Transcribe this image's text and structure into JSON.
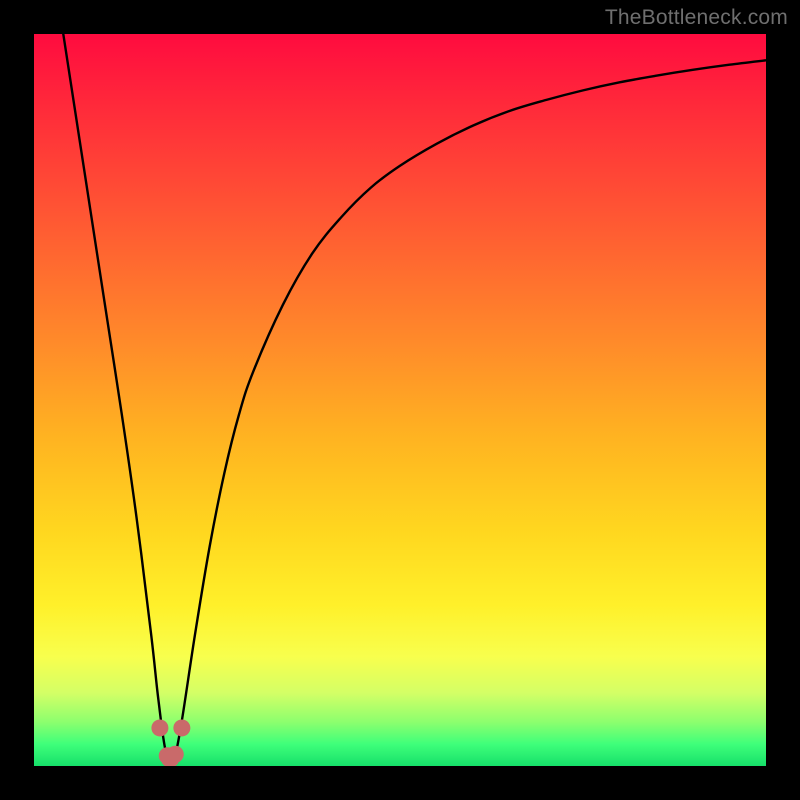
{
  "watermark": "TheBottleneck.com",
  "colors": {
    "frame": "#000000",
    "curve_stroke": "#000000",
    "marker_fill": "#c96a6a",
    "marker_stroke": "#c96a6a",
    "gradient_top": "#ff0b3f",
    "gradient_bottom": "#16e06a"
  },
  "chart_data": {
    "type": "line",
    "title": "",
    "xlabel": "",
    "ylabel": "",
    "xlim": [
      0,
      100
    ],
    "ylim": [
      0,
      100
    ],
    "x": [
      4,
      6,
      8,
      10,
      12,
      14,
      16,
      17,
      18,
      19,
      20,
      22,
      24,
      26,
      28,
      30,
      34,
      38,
      42,
      46,
      50,
      55,
      60,
      65,
      70,
      75,
      80,
      85,
      90,
      95,
      100
    ],
    "values": [
      100,
      87,
      74,
      61,
      48,
      34,
      18,
      9,
      2,
      1,
      5,
      18,
      30,
      40,
      48,
      54,
      63,
      70,
      75,
      79,
      82,
      85,
      87.5,
      89.5,
      91,
      92.3,
      93.4,
      94.3,
      95.1,
      95.8,
      96.4
    ],
    "markers_x": [
      17.2,
      18.2,
      18.5,
      18.7,
      19.3,
      20.2
    ],
    "markers_y": [
      5.2,
      1.4,
      1.0,
      1.0,
      1.6,
      5.2
    ],
    "note": "x and y are in percent of the plot area; curve plunges to ~0 near x≈18.6 then rises asymptotically toward the top-right."
  }
}
